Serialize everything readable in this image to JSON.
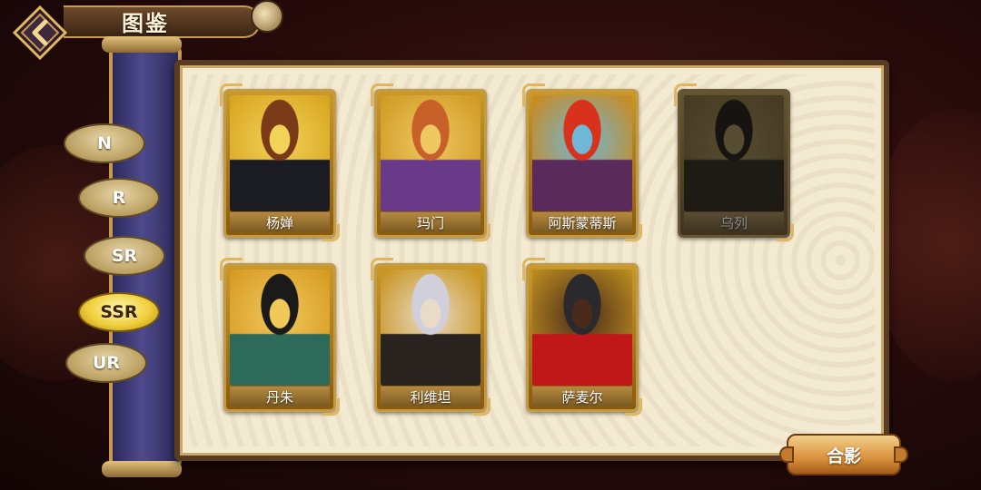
{
  "header": {
    "title": "图鉴",
    "back_icon": "chevron-left-icon"
  },
  "rarity_tabs": [
    {
      "label": "N",
      "active": false
    },
    {
      "label": "R",
      "active": false
    },
    {
      "label": "SR",
      "active": false
    },
    {
      "label": "SSR",
      "active": true
    },
    {
      "label": "UR",
      "active": false
    }
  ],
  "cards": [
    {
      "name": "杨婵",
      "locked": false,
      "palette": [
        "#d9a520",
        "#f2d35a",
        "#7a3a18",
        "#1b1b22"
      ]
    },
    {
      "name": "玛门",
      "locked": false,
      "palette": [
        "#d09a24",
        "#f0c862",
        "#c8602a",
        "#6a3a8a"
      ]
    },
    {
      "name": "阿斯蒙蒂斯",
      "locked": false,
      "palette": [
        "#c98a20",
        "#6fb8d8",
        "#d8321c",
        "#5a2a5a"
      ]
    },
    {
      "name": "乌列",
      "locked": true,
      "palette": [
        "#8a6a20",
        "#a88a3a",
        "#2a2218",
        "#3a3020"
      ]
    },
    {
      "name": "丹朱",
      "locked": false,
      "palette": [
        "#d89a24",
        "#f0c95a",
        "#1a1a1a",
        "#2e6a5a"
      ]
    },
    {
      "name": "利维坦",
      "locked": false,
      "palette": [
        "#c99420",
        "#e8dcc8",
        "#d0d0dc",
        "#2a2420"
      ]
    },
    {
      "name": "萨麦尔",
      "locked": false,
      "palette": [
        "#b88a20",
        "#4a2a1a",
        "#2a2a2e",
        "#c01818"
      ]
    }
  ],
  "actions": {
    "group_photo_label": "合影"
  },
  "colors": {
    "parchment": "#f3ead2",
    "gold_frame": "#c59a45",
    "active_tab": "#f0cf3c",
    "button_orange": "#d9913c"
  }
}
